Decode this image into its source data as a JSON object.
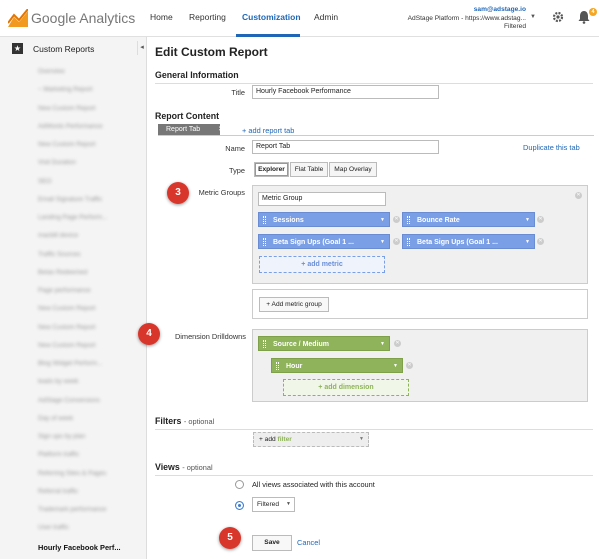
{
  "topbar": {
    "logo": "Google Analytics",
    "nav": [
      "Home",
      "Reporting",
      "Customization",
      "Admin"
    ],
    "account": {
      "email": "sam@adstage.io",
      "property": "AdStage Platform - https://www.adstag...",
      "view": "Filtered"
    },
    "notification_count": "4"
  },
  "sidebar": {
    "header": "Custom Reports",
    "items": [
      "Overview",
      "~ Marketing Report",
      "New Custom Report",
      "AdWords Performance",
      "New Custom Report",
      "Visit Duration",
      "SEO",
      "Email Signature Traffic",
      "Landing Page Perform...",
      "macbill device",
      "Traffic Sources",
      "Betas Redeemed",
      "Page performance",
      "New Custom Report",
      "New Custom Report",
      "New Custom Report",
      "Blog Widget Perform...",
      "leads by week",
      "AdStage Conversions",
      "Day of week",
      "Sign ups by plan",
      "Platform traffic",
      "Referring Sites & Pages",
      "Referral traffic",
      "Trademark performance",
      "User traffic",
      "Hourly Facebook Perf..."
    ]
  },
  "main": {
    "title": "Edit Custom Report",
    "general_info": "General Information",
    "title_label": "Title",
    "title_value": "Hourly Facebook Performance",
    "report_content": "Report Content",
    "tab_name": "Report Tab",
    "add_tab": "+ add report tab",
    "name_label": "Name",
    "name_value": "Report Tab",
    "duplicate": "Duplicate this tab",
    "type_label": "Type",
    "types": [
      "Explorer",
      "Flat Table",
      "Map Overlay"
    ],
    "metric_groups_label": "Metric Groups",
    "metric_group_name": "Metric Group",
    "metrics": [
      "Sessions",
      "Bounce Rate",
      "Beta Sign Ups (Goal 1 ...",
      "Beta Sign Ups (Goal 1 ..."
    ],
    "add_metric": "+ add metric",
    "add_metric_group": "+ Add metric group",
    "dimension_label": "Dimension Drilldowns",
    "dimensions": [
      "Source / Medium",
      "Hour"
    ],
    "add_dimension": "+ add dimension",
    "filters": "Filters",
    "optional": "- optional",
    "add_filter_prefix": "+ add",
    "add_filter_word": "filter",
    "views": "Views",
    "view_all": "All views associated with this account",
    "view_selected": "Filtered",
    "save": "Save",
    "cancel": "Cancel",
    "steps": [
      "3",
      "4",
      "5"
    ]
  }
}
